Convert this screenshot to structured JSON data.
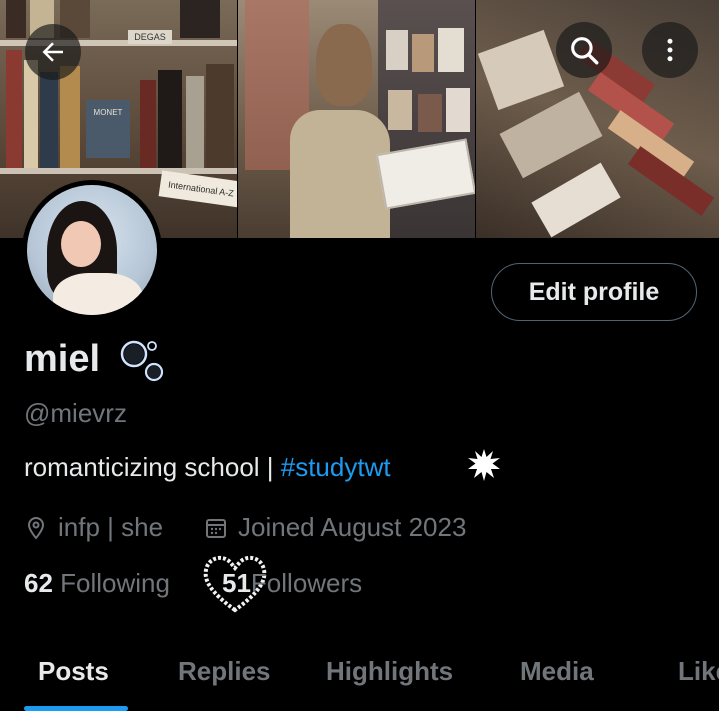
{
  "banner": {
    "sign_top": "DEGAS",
    "sign_bottom": "International A-Z",
    "book_title": "MONET"
  },
  "nav": {
    "back_icon": "arrow-left-icon",
    "search_icon": "search-icon",
    "more_icon": "more-vertical-icon"
  },
  "profile": {
    "edit_label": "Edit profile",
    "name": "miel",
    "handle": "@mievrz",
    "bio_text": "romanticizing school | ",
    "bio_hashtag": "#studytwt",
    "location": "infp | she",
    "joined": "Joined August 2023",
    "following_count": "62",
    "following_label": " Following",
    "followers_count": "51",
    "followers_label": "Followers"
  },
  "tabs": [
    "Posts",
    "Replies",
    "Highlights",
    "Media",
    "Likes"
  ],
  "colors": {
    "accent": "#1d9bf0",
    "muted": "#71767b",
    "text": "#e7e9ea",
    "background": "#000000"
  }
}
